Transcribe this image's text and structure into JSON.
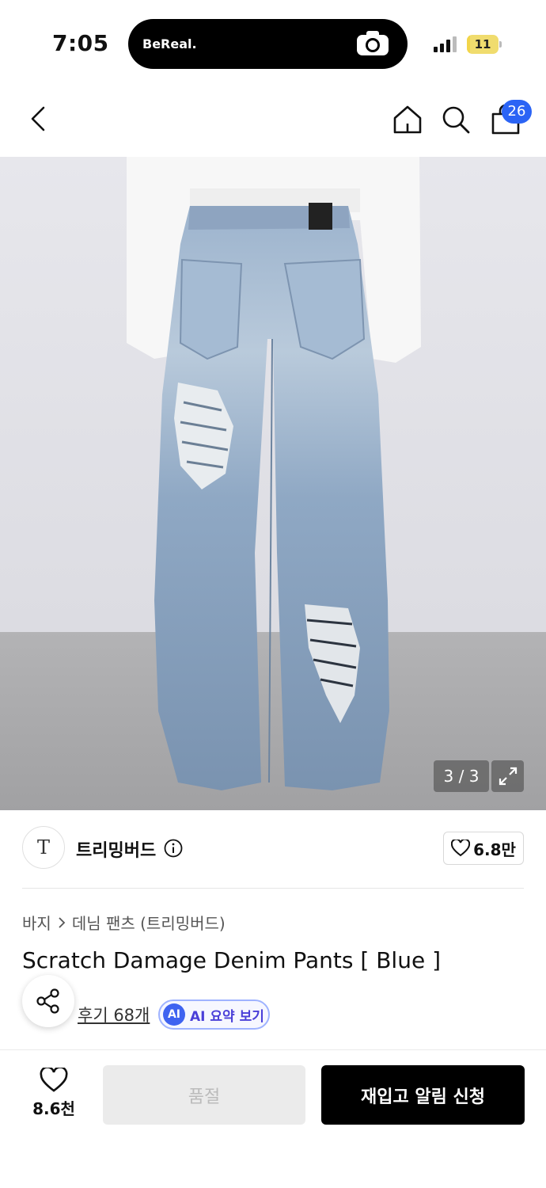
{
  "status_bar": {
    "time": "7:05",
    "island_app": "BeReal.",
    "battery": "11",
    "battery_level": 0.11
  },
  "nav": {
    "icons": [
      "back-icon",
      "home-icon",
      "search-icon",
      "cart-icon"
    ],
    "cart_count": "26"
  },
  "gallery": {
    "counter": "3 / 3",
    "expand_icon": "expand-icon"
  },
  "brand": {
    "logo_text": "T",
    "name": "트리밍버드",
    "likes": "6.8만"
  },
  "breadcrumb": {
    "category": "바지",
    "subcategory": "데님 팬츠 (트리밍버드)"
  },
  "product": {
    "title": "Scratch Damage Denim Pants [ Blue ]",
    "reviews": "후기 68개",
    "ai_badge": "AI",
    "ai_summary": "AI 요약 보기"
  },
  "bottom_bar": {
    "wish_count": "8.6천",
    "soldout_label": "품절",
    "restock_label": "재입고 알림 신청"
  },
  "colors": {
    "accent_blue": "#2b64f5",
    "ai_purple": "#4a3fd8",
    "primary_button": "#000000",
    "disabled_button": "#ebebeb"
  }
}
